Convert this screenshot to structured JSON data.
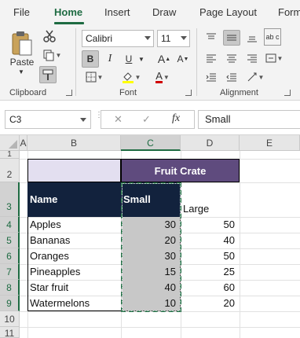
{
  "tabs": [
    "File",
    "Home",
    "Insert",
    "Draw",
    "Page Layout",
    "Form"
  ],
  "active_tab": "Home",
  "ribbon": {
    "clipboard": {
      "paste_label": "Paste",
      "group_label": "Clipboard"
    },
    "font": {
      "font_name": "Calibri",
      "font_size": "11",
      "group_label": "Font",
      "bold": "B",
      "italic": "I",
      "underline": "U"
    },
    "alignment": {
      "group_label": "Alignment",
      "wrap_text_label": "ab c"
    }
  },
  "formula_bar": {
    "name_box": "C3",
    "fx_label": "fx",
    "cancel": "✕",
    "enter": "✓",
    "value": "Small"
  },
  "columns": [
    "A",
    "B",
    "C",
    "D",
    "E"
  ],
  "selected_column": "C",
  "rows": [
    "1",
    "2",
    "3",
    "4",
    "5",
    "6",
    "7",
    "8",
    "9",
    "10",
    "11"
  ],
  "sheet": {
    "merged_title": "Fruit Crate",
    "header": {
      "name": "Name",
      "small": "Small",
      "large": "Large"
    },
    "data": [
      {
        "name": "Apples",
        "small": "30",
        "large": "50"
      },
      {
        "name": "Bananas",
        "small": "20",
        "large": "40"
      },
      {
        "name": "Oranges",
        "small": "30",
        "large": "50"
      },
      {
        "name": "Pineapples",
        "small": "15",
        "large": "25"
      },
      {
        "name": "Star fruit",
        "small": "40",
        "large": "60"
      },
      {
        "name": "Watermelons",
        "small": "10",
        "large": "20"
      }
    ]
  },
  "colors": {
    "accent": "#1e6b42",
    "title_fill": "#5f4b7e",
    "header_fill": "#12223d",
    "lavender": "#e3dff0",
    "selection_fill": "#c8c8c8"
  }
}
